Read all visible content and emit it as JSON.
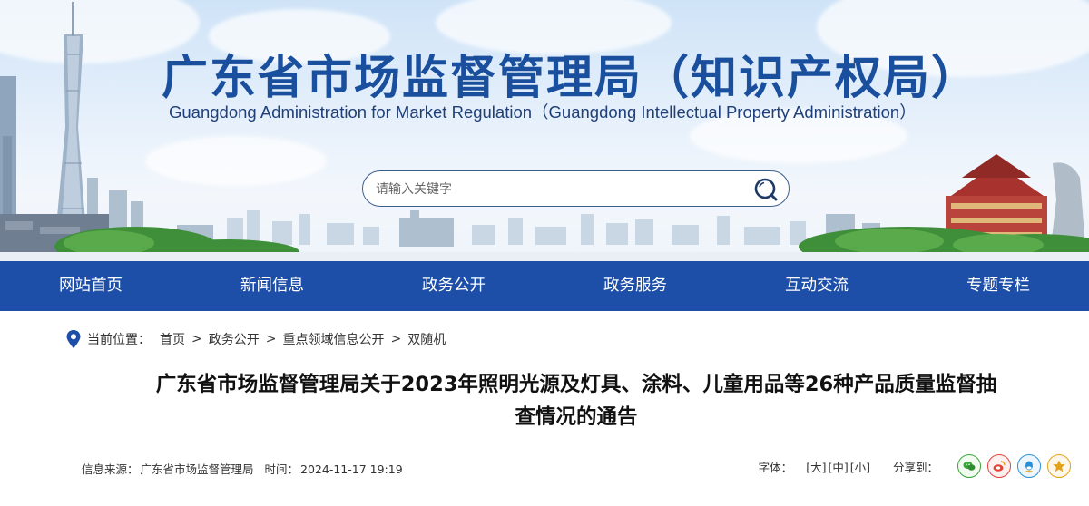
{
  "header": {
    "title": "广东省市场监督管理局（知识产权局）",
    "subtitle": "Guangdong Administration for Market Regulation（Guangdong Intellectual Property Administration）",
    "search_placeholder": "请输入关键字",
    "search_icon": "search-icon"
  },
  "nav": {
    "items": [
      "网站首页",
      "新闻信息",
      "政务公开",
      "政务服务",
      "互动交流",
      "专题专栏"
    ]
  },
  "breadcrumb": {
    "label": "当前位置：",
    "items": [
      "首页",
      "政务公开",
      "重点领域信息公开",
      "双随机"
    ],
    "separator": ">"
  },
  "article": {
    "title_line1": "广东省市场监督管理局关于2023年照明光源及灯具、涂料、儿童用品等26种产品质量监督抽",
    "title_line2": "查情况的通告",
    "source_label": "信息来源：",
    "source": "广东省市场监督管理局",
    "time_label": "时间：",
    "time": "2024-11-17 19:19"
  },
  "tools": {
    "font_label": "字体：",
    "font_large": "[大]",
    "font_medium": "[中]",
    "font_small": "[小]",
    "share_label": "分享到：",
    "share_icons": [
      "wechat-icon",
      "weibo-icon",
      "qq-icon",
      "favorite-icon"
    ]
  },
  "colors": {
    "nav_bg": "#1e4fa8",
    "title_blue": "#1a4f9e"
  }
}
